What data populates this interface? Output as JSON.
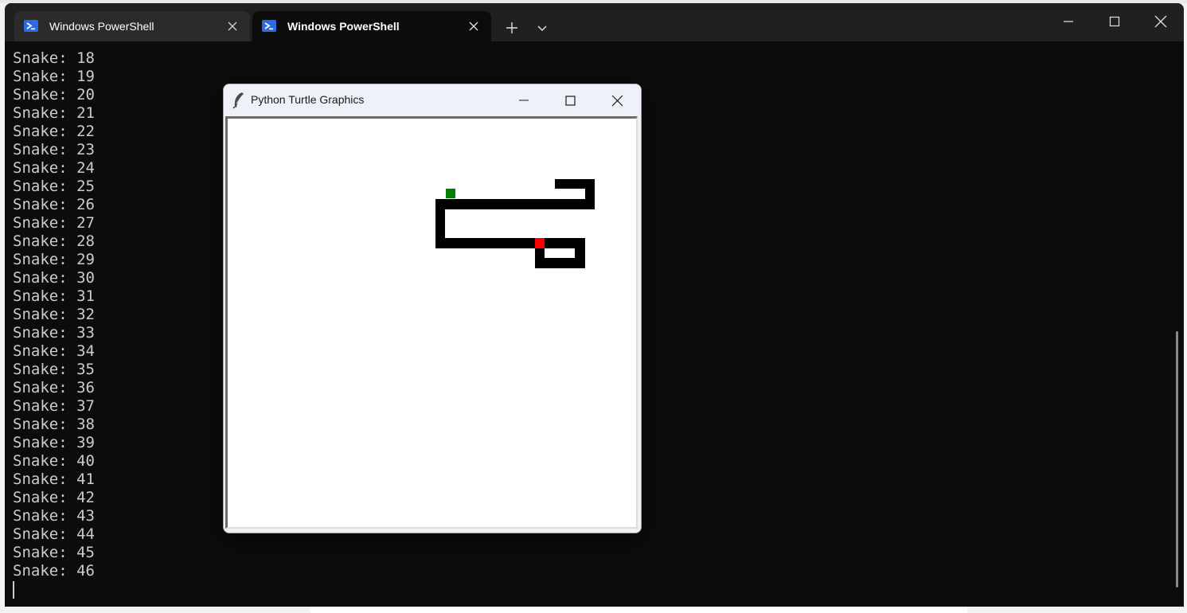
{
  "terminal": {
    "tabs": [
      {
        "label": "Windows PowerShell",
        "icon": "powershell-icon",
        "active": false
      },
      {
        "label": "Windows PowerShell",
        "icon": "powershell-icon",
        "active": true
      }
    ],
    "new_tab_symbol": "+",
    "lines": [
      "Snake: 18",
      "Snake: 19",
      "Snake: 20",
      "Snake: 21",
      "Snake: 22",
      "Snake: 23",
      "Snake: 24",
      "Snake: 25",
      "Snake: 26",
      "Snake: 27",
      "Snake: 28",
      "Snake: 29",
      "Snake: 30",
      "Snake: 31",
      "Snake: 32",
      "Snake: 33",
      "Snake: 34",
      "Snake: 35",
      "Snake: 36",
      "Snake: 37",
      "Snake: 38",
      "Snake: 39",
      "Snake: 40",
      "Snake: 41",
      "Snake: 42",
      "Snake: 43",
      "Snake: 44",
      "Snake: 45",
      "Snake: 46"
    ]
  },
  "turtle_window": {
    "title": "Python Turtle Graphics",
    "icon": "feather-icon",
    "colors": {
      "snake": "#000000",
      "food": "#008000",
      "head": "#ff0000",
      "canvas": "#ffffff"
    }
  },
  "colors": {
    "terminal_bg": "#0c0c0c",
    "tabbar_bg": "#202020",
    "text": "#cccccc",
    "powershell_icon": "#2d6ae3"
  }
}
